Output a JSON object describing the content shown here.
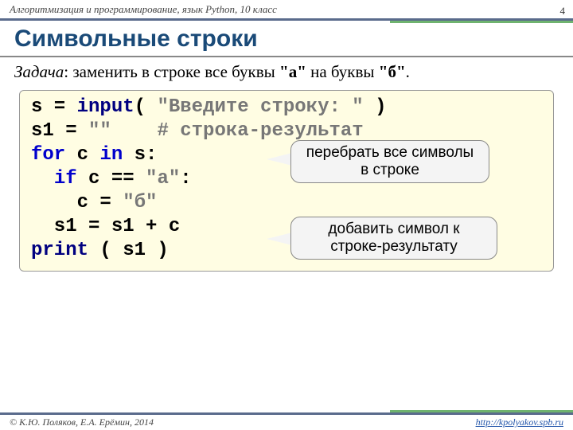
{
  "header": {
    "course": "Алгоритмизация и программирование, язык Python, 10 класс",
    "page": "4"
  },
  "title": "Символьные строки",
  "task": {
    "label": "Задача",
    "text": ": заменить в строке все буквы ",
    "letter1": "\"а\"",
    "mid": " на буквы ",
    "letter2": "\"б\"",
    "end": "."
  },
  "code": {
    "l1a": "s = ",
    "l1b": "input",
    "l1c": "( ",
    "l1d": "\"Введите строку: \"",
    "l1e": " )",
    "l2a": "s1 = ",
    "l2b": "\"\"",
    "l2c": "    ",
    "l2d": "# строка-результат",
    "l3a": "for",
    "l3b": " c ",
    "l3c": "in",
    "l3d": " s:",
    "l4a": "  ",
    "l4b": "if",
    "l4c": " c == ",
    "l4d": "\"а\"",
    "l4e": ":",
    "l5a": "    c = ",
    "l5b": "\"б\"",
    "l6": "  s1 = s1 + c",
    "l7a": "print",
    "l7b": " ( s1 )"
  },
  "bubbles": {
    "b1": "перебрать все символы в строке",
    "b2": "добавить символ к строке-результату"
  },
  "footer": {
    "copyright": "© К.Ю. Поляков, Е.А. Ерёмин, 2014",
    "url": "http://kpolyakov.spb.ru"
  }
}
